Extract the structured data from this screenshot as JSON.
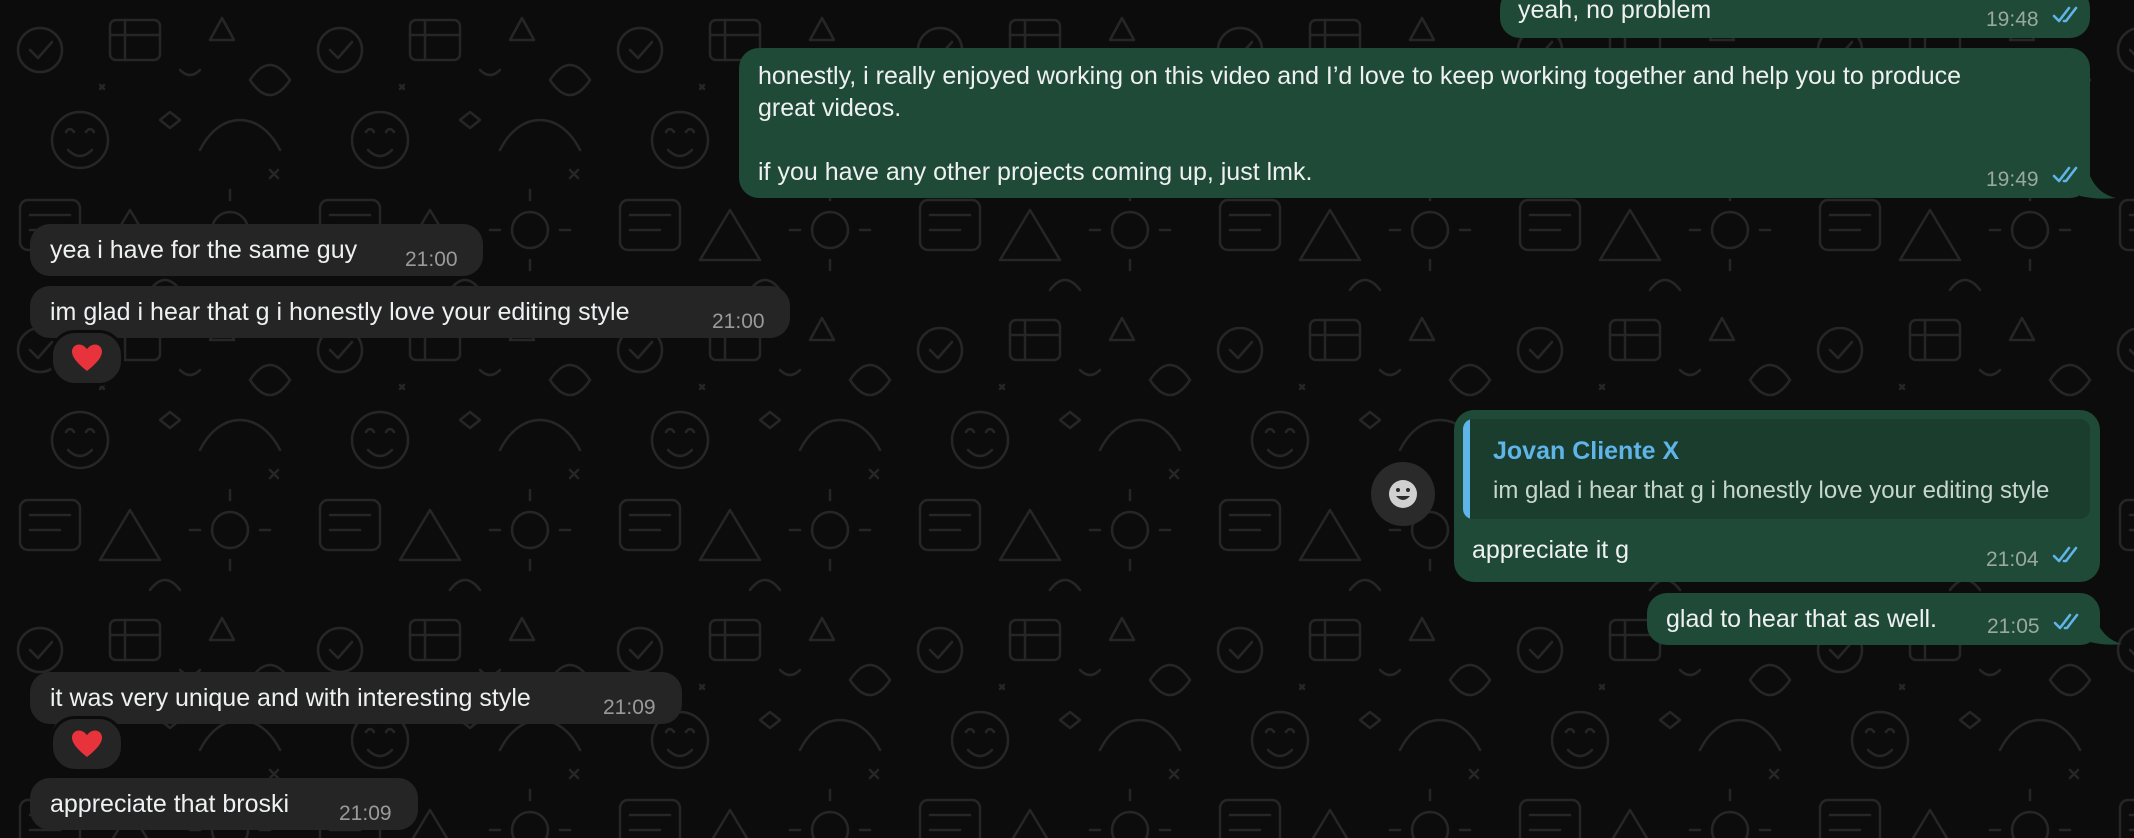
{
  "colors": {
    "background": "#0c0c0c",
    "outgoing_bubble": "#1f4a37",
    "incoming_bubble": "#252525",
    "read_ticks": "#5fb4e8",
    "quote_accent": "#5fb4e8"
  },
  "messages": [
    {
      "direction": "outgoing",
      "text": "yeah, no problem",
      "time": "19:48",
      "status": "read"
    },
    {
      "direction": "outgoing",
      "lines": [
        "honestly, i really enjoyed working on this video and I’d love to keep working together and help you to produce",
        "great videos.",
        "if you have any other projects coming up, just lmk."
      ],
      "time": "19:49",
      "status": "read"
    },
    {
      "direction": "incoming",
      "text": "yea i have for the same guy",
      "time": "21:00"
    },
    {
      "direction": "incoming",
      "text": "im glad i hear that g i honestly love your editing style",
      "time": "21:00",
      "reaction": "heart"
    },
    {
      "direction": "outgoing",
      "reply_to": {
        "author": "Jovan Cliente X",
        "text": "im glad i hear that g i honestly love your editing style"
      },
      "text": "appreciate it g",
      "time": "21:04",
      "status": "read"
    },
    {
      "direction": "outgoing",
      "text": "glad to hear that as well.",
      "time": "21:05",
      "status": "read"
    },
    {
      "direction": "incoming",
      "text": "it was very unique and with interesting style",
      "time": "21:09",
      "reaction": "heart"
    },
    {
      "direction": "incoming",
      "text": "appreciate that broski",
      "time": "21:09"
    }
  ],
  "icons": {
    "read_status": "double-check-icon",
    "reaction": "heart-icon",
    "emoji_picker": "smiley-icon"
  }
}
